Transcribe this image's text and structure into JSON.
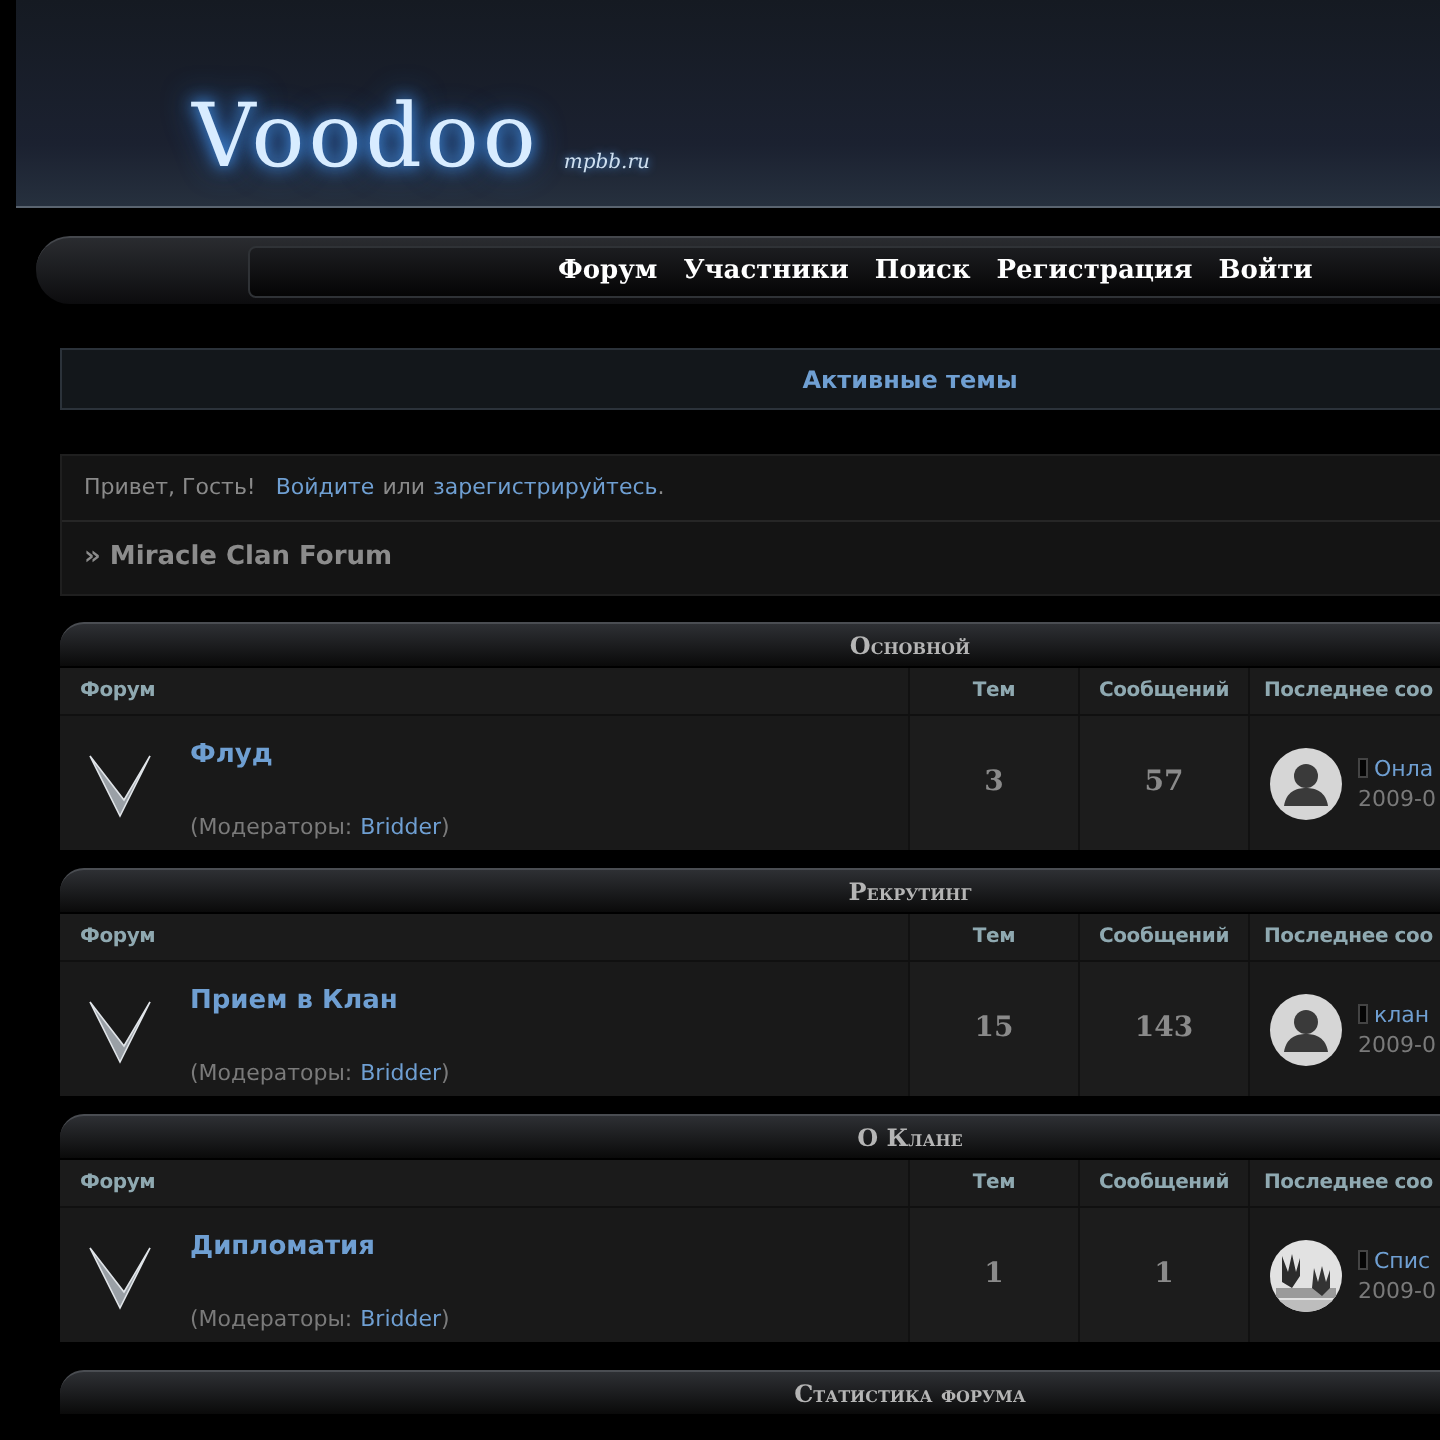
{
  "header": {
    "logo": "Voodoo",
    "logo_sub": "mpbb.ru"
  },
  "nav": [
    {
      "label": "Форум"
    },
    {
      "label": "Участники"
    },
    {
      "label": "Поиск"
    },
    {
      "label": "Регистрация"
    },
    {
      "label": "Войти"
    }
  ],
  "active_topics": "Активные темы",
  "welcome": {
    "greeting": "Привет, Гость!",
    "login": "Войдите",
    "or": "или",
    "register": "зарегистрируйтесь",
    "end": "."
  },
  "breadcrumb": "» Miracle Clan Forum",
  "categories": [
    {
      "title": "Основной",
      "columns": [
        "Форум",
        "Тем",
        "Сообщений",
        "Последнее соо"
      ],
      "forums": [
        {
          "name": "Флуд",
          "moderators_label": "(Модераторы:",
          "moderator": "Bridder",
          "close": ")",
          "topics": "3",
          "posts": "57",
          "last_post": {
            "title": "Онла",
            "date": "2009-0",
            "kind": "silhouette"
          }
        }
      ]
    },
    {
      "title": "Рекрутинг",
      "columns": [
        "Форум",
        "Тем",
        "Сообщений",
        "Последнее соо"
      ],
      "forums": [
        {
          "name": "Прием в Клан",
          "moderators_label": "(Модераторы:",
          "moderator": "Bridder",
          "close": ")",
          "topics": "15",
          "posts": "143",
          "last_post": {
            "title": "клан",
            "date": "2009-0",
            "kind": "silhouette"
          }
        }
      ]
    },
    {
      "title": "О Клане",
      "columns": [
        "Форум",
        "Тем",
        "Сообщений",
        "Последнее соо"
      ],
      "forums": [
        {
          "name": "Дипломатия",
          "moderators_label": "(Модераторы:",
          "moderator": "Bridder",
          "close": ")",
          "topics": "1",
          "posts": "1",
          "last_post": {
            "title": "Спис",
            "date": "2009-0",
            "kind": "picture"
          }
        }
      ]
    }
  ],
  "stats": {
    "title": "Статистика форума"
  }
}
